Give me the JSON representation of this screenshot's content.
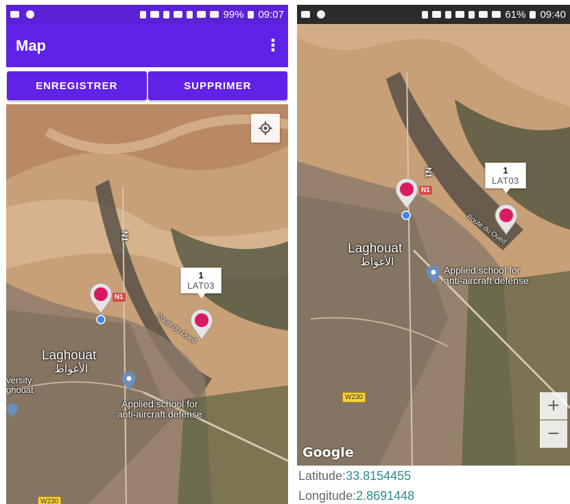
{
  "left_screen": {
    "status": {
      "battery": "99%",
      "time": "09:07"
    },
    "toolbar": {
      "title": "Map",
      "menu_icon": "overflow-menu-icon"
    },
    "buttons": {
      "save": "ENREGISTRER",
      "delete": "SUPPRIMER"
    },
    "map": {
      "city_label": "Laghouat",
      "city_label_ar": "الأغواط",
      "poi_label_line1": "Applied school for",
      "poi_label_line2": "anti-aircraft defense",
      "univ_label_line1": "versity",
      "univ_label_line2": "ghouat",
      "road_label": "Route du Oued",
      "road_n1": "N1",
      "road_w230": "W230",
      "n1_vertical": "N1",
      "marker_info": {
        "title": "1",
        "snippet": "LAT03"
      }
    }
  },
  "right_screen": {
    "status": {
      "battery": "61%",
      "time": "09:40"
    },
    "map": {
      "city_label": "Laghouat",
      "city_label_ar": "الأغواط",
      "poi_label_line1": "Applied school for",
      "poi_label_line2": "anti-aircraft defense",
      "road_label": "Route du Oued",
      "road_n1": "N1",
      "road_w230": "W230",
      "n1_vertical": "N1",
      "marker_info": {
        "title": "1",
        "snippet": "LAT03"
      },
      "zoom_in": "+",
      "zoom_out": "−",
      "attribution": "Google"
    },
    "coords": {
      "lat_label": "Latitude:",
      "lat_value": "33.8154455",
      "lon_label": "Longitude:",
      "lon_value": "2.8691448"
    }
  },
  "colors": {
    "primary": "#6022e6",
    "marker": "#d81b60",
    "coord_value": "#2e8b88"
  }
}
